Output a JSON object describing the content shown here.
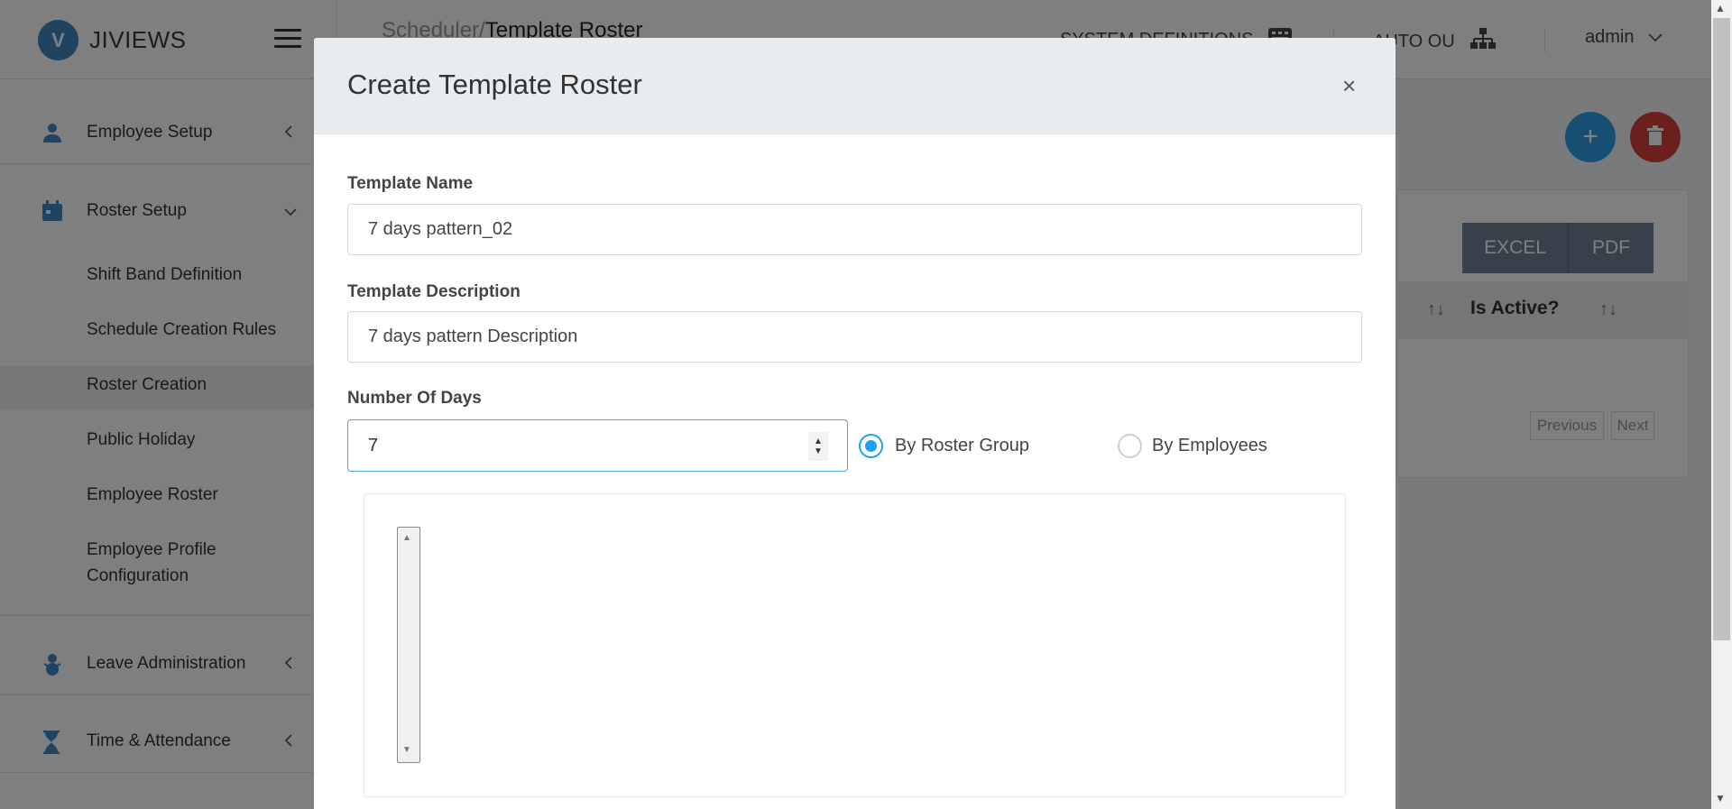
{
  "app": {
    "name": "JIVIEWS",
    "logo_letter": "V"
  },
  "breadcrumb": {
    "parent": "Scheduler/",
    "current": "Template Roster"
  },
  "topnav": {
    "system_definitions": "SYSTEM DEFINITIONS",
    "auto_ou": "AUTO OU",
    "user": "admin"
  },
  "sidebar": {
    "groups": [
      {
        "label": "Employee Setup",
        "icon": "user-icon",
        "chevron": "<"
      },
      {
        "label": "Roster Setup",
        "icon": "calendar-icon",
        "chevron": "v"
      },
      {
        "label": "Leave Administration",
        "icon": "snowman-icon",
        "chevron": "<"
      },
      {
        "label": "Time & Attendance",
        "icon": "hourglass-icon",
        "chevron": "<"
      }
    ],
    "roster_items": [
      "Shift Band Definition",
      "Schedule Creation Rules",
      "Roster Creation",
      "Public Holiday",
      "Employee Roster",
      "Employee Profile",
      "Configuration"
    ],
    "active_item": "Roster Creation"
  },
  "actions": {
    "add": "+",
    "delete": "trash-icon"
  },
  "table": {
    "export_buttons": [
      "EXCEL",
      "PDF"
    ],
    "column": "Is Active?",
    "sort_glyph": "↑↓",
    "pagination": {
      "previous": "Previous",
      "next": "Next"
    }
  },
  "modal": {
    "title": "Create Template Roster",
    "close": "×",
    "template_name": {
      "label": "Template Name",
      "value": "7 days pattern_02"
    },
    "template_description": {
      "label": "Template Description",
      "value": "7 days pattern Description"
    },
    "number_of_days": {
      "label": "Number Of Days",
      "value": "7"
    },
    "assign_by": {
      "options": [
        "By Roster Group",
        "By Employees"
      ],
      "selected": "By Roster Group"
    }
  },
  "colors": {
    "accent": "#1da1f2",
    "brand": "#3f88c5",
    "add_button": "#2d9ce8",
    "delete_button": "#d9413d",
    "export_button": "#6f8296"
  }
}
